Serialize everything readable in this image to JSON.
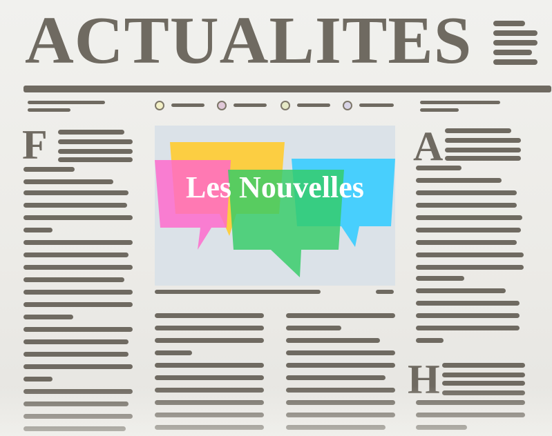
{
  "masthead": {
    "title": "ACTUALITES"
  },
  "hero": {
    "caption": "Les Nouvelles"
  },
  "dropcaps": {
    "left": "F",
    "right_top": "A",
    "right_bottom": "H"
  },
  "colors": {
    "ink": "#6f6a61",
    "paper": "#efeeea",
    "hero_bg": "#dbe2e8",
    "bubble_yellow": "#ffcc33",
    "bubble_pink": "#ff66cc",
    "bubble_blue": "#33ccff",
    "bubble_green": "#33cc66"
  }
}
